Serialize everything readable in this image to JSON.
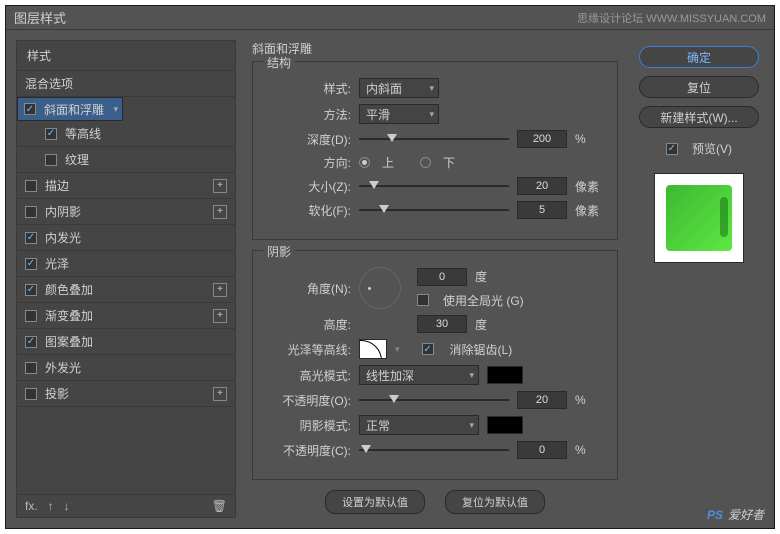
{
  "title": "图层样式",
  "attribution": "思缘设计论坛  WWW.MISSYUAN.COM",
  "left": {
    "header": "样式",
    "blend": "混合选项",
    "items": [
      {
        "label": "斜面和浮雕",
        "checked": true,
        "selected": true,
        "expand": false
      },
      {
        "label": "等高线",
        "checked": true,
        "sub": true
      },
      {
        "label": "纹理",
        "checked": false,
        "sub": true
      },
      {
        "label": "描边",
        "checked": false,
        "expand": true
      },
      {
        "label": "内阴影",
        "checked": false,
        "expand": true
      },
      {
        "label": "内发光",
        "checked": true
      },
      {
        "label": "光泽",
        "checked": true
      },
      {
        "label": "颜色叠加",
        "checked": true,
        "expand": true
      },
      {
        "label": "渐变叠加",
        "checked": false,
        "expand": true
      },
      {
        "label": "图案叠加",
        "checked": true
      },
      {
        "label": "外发光",
        "checked": false
      },
      {
        "label": "投影",
        "checked": false,
        "expand": true
      }
    ]
  },
  "mid": {
    "title": "斜面和浮雕",
    "structure": {
      "legend": "结构",
      "style": {
        "label": "样式:",
        "value": "内斜面"
      },
      "technique": {
        "label": "方法:",
        "value": "平滑"
      },
      "depth": {
        "label": "深度(D):",
        "value": "200",
        "unit": "%"
      },
      "direction": {
        "label": "方向:",
        "up": "上",
        "down": "下"
      },
      "size": {
        "label": "大小(Z):",
        "value": "20",
        "unit": "像素"
      },
      "soften": {
        "label": "软化(F):",
        "value": "5",
        "unit": "像素"
      }
    },
    "shadow": {
      "legend": "阴影",
      "angle": {
        "label": "角度(N):",
        "value": "0",
        "unit": "度"
      },
      "global": {
        "label": "使用全局光 (G)"
      },
      "altitude": {
        "label": "高度:",
        "value": "30",
        "unit": "度"
      },
      "gloss": {
        "label": "光泽等高线:"
      },
      "antialias": {
        "label": "消除锯齿(L)"
      },
      "hlmode": {
        "label": "高光模式:",
        "value": "线性加深"
      },
      "hlopacity": {
        "label": "不透明度(O):",
        "value": "20",
        "unit": "%"
      },
      "shmode": {
        "label": "阴影模式:",
        "value": "正常"
      },
      "shopacity": {
        "label": "不透明度(C):",
        "value": "0",
        "unit": "%"
      }
    },
    "defaults": {
      "set": "设置为默认值",
      "reset": "复位为默认值"
    }
  },
  "right": {
    "ok": "确定",
    "cancel": "复位",
    "newstyle": "新建样式(W)...",
    "preview": "预览(V)"
  },
  "watermark": {
    "a": "PS",
    "b": "爱好者"
  }
}
